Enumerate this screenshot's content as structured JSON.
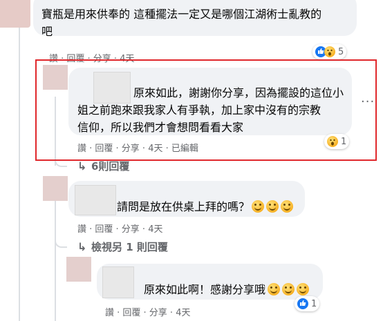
{
  "comments": [
    {
      "text_lines": [
        "寶瓶是用來供奉的 這種擺法一定又是哪個江湖術士亂教的",
        "吧"
      ],
      "actions": "讚 · 回覆 · 分享 · 4天",
      "reaction_count": "5",
      "reaction_icons": [
        "like-icon",
        "wow-icon"
      ]
    },
    {
      "text_lines": [
        "原來如此，謝謝你分享，因為擺設的這位小",
        "姐之前跑來跟我家人有爭執，加上家中沒有的宗教",
        "信仰，所以我們才會想問看看大家"
      ],
      "actions": "讚 · 回覆 · 分享 · 4天 · 已編輯",
      "reaction_count": "1",
      "reaction_icons": [
        "wow-icon"
      ],
      "more_label": "···"
    },
    {
      "reply_link": "6則回覆"
    },
    {
      "text": "請問是放在供桌上拜的嗎？",
      "emoji_count": 3,
      "actions": "讚 · 回覆 · 分享 · 4天"
    },
    {
      "reply_link": "檢視另 1 則回覆"
    },
    {
      "text": "原來如此啊！感謝分享哦",
      "emoji_count": 3,
      "actions": "讚 · 回覆 · 分享 · 4天",
      "reaction_count": "1",
      "reaction_icons": [
        "like-icon"
      ]
    }
  ],
  "colors": {
    "highlight": "#e0272b",
    "bubble": "#f0f2f5",
    "meta": "#65676b",
    "like": "#1877f2"
  }
}
